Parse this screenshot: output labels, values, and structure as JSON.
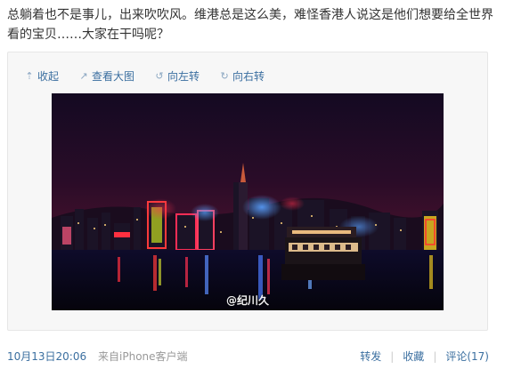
{
  "post": {
    "text": "总躺着也不是事儿，出来吹吹风。维港总是这么美，难怪香港人说这是他们想要给全世界看的宝贝……大家在干吗呢？"
  },
  "toolbar": {
    "collapse_label": "收起",
    "view_large_label": "查看大图",
    "rotate_left_label": "向左转",
    "rotate_right_label": "向右转"
  },
  "image": {
    "watermark": "@纪川久",
    "subject": "Victoria Harbour night skyline"
  },
  "footer": {
    "time": "10月13日20:06",
    "source_prefix": "来自",
    "source_name": "iPhone客户端",
    "repost_label": "转发",
    "favorite_label": "收藏",
    "comment_label": "评论(17)"
  },
  "colors": {
    "link": "#3b6fa0",
    "muted": "#999999",
    "text": "#333333"
  },
  "icons": [
    "collapse-icon",
    "view-large-icon",
    "rotate-left-icon",
    "rotate-right-icon"
  ]
}
